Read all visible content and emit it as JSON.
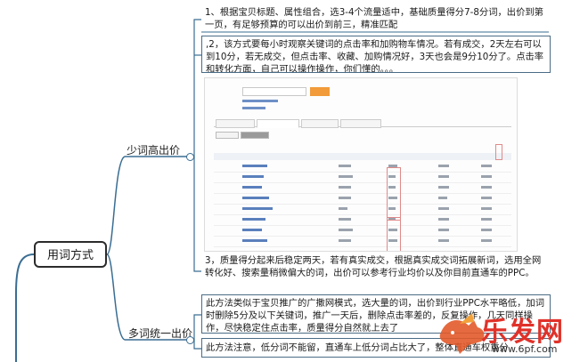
{
  "root": {
    "label": "用词方式"
  },
  "branch_few": {
    "label": "少词高出价",
    "note1": "1、根据宝贝标题、属性组合，选3-4个流量适中，基础质量得分7-8分词，出价到第一页，有足够预算的可以出价到前三，精准匹配",
    "note2": ",2，该方式要每小时观察关键词的点击率和加购物车情况。若有成交，2天左右可以到10分，若无成交，但点击率、收藏、加购情况好，3天也会是9分10分了。点击率和转化方面，自己可以操作操作，你们懂的。。。",
    "note3": "3，质量得分起来后稳定两天，若有真实成交，根据真实成交词拓展新词，选用全网转化好、搜索量稍微偏大的词，出价可以参考行业均价以及你目前直通车的PPC。"
  },
  "branch_many": {
    "label": "多词统一出价",
    "note1": "此方法类似于宝贝推广的广撒网模式，选大量的词，出价到行业PPC水平略低，加词时删除5分及以下关键词，推广一天后，删除点击率差的，反复操作，几天同样操作，尽快稳定住点击率，质量得分自然就上去了",
    "note2": "此方法注意，低分词不能留，直通车上低分词占比大了，整体直通车权重分"
  },
  "watermark": {
    "brand": "乐发网",
    "url": "www.6pf.com"
  },
  "colors": {
    "line": "#3a6d92",
    "box_border": "#4a6c86",
    "brand_red": "#e0322a"
  }
}
